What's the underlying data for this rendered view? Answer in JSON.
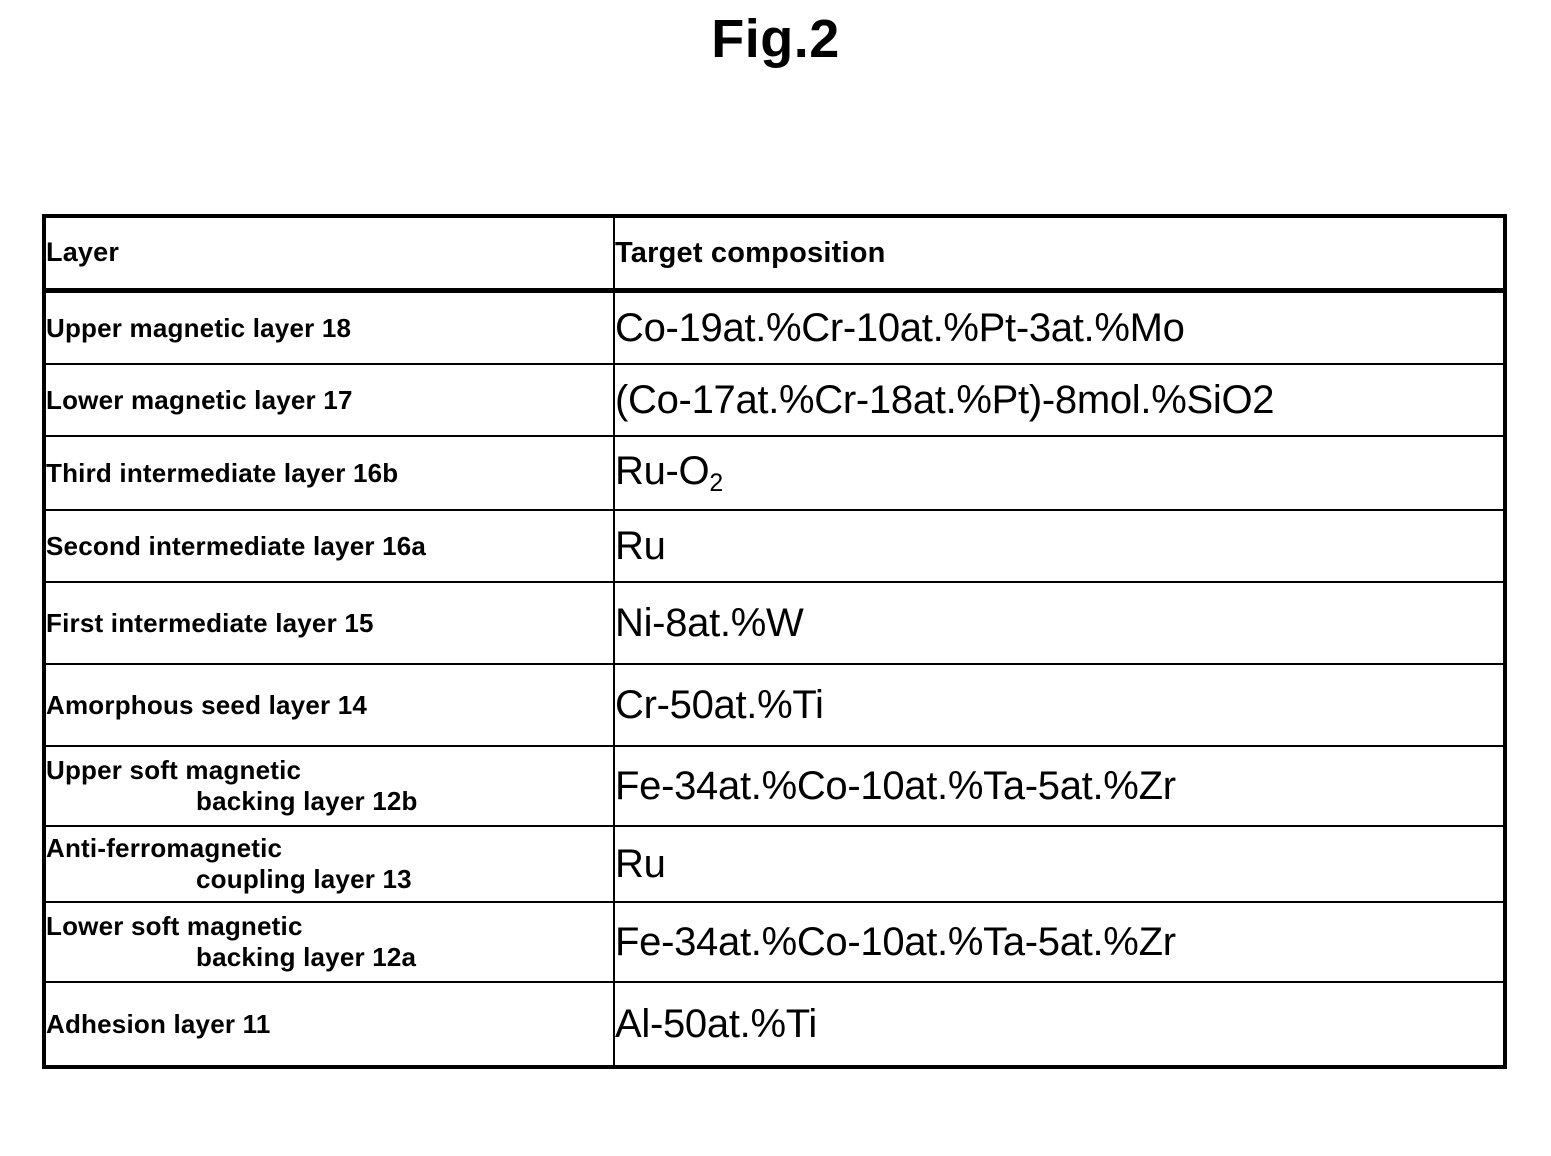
{
  "figure": {
    "title": "Fig.2"
  },
  "table": {
    "headers": {
      "layer": "Layer",
      "composition": "Target composition"
    },
    "rows": [
      {
        "layer_line1": "Upper magnetic layer 18",
        "layer_line2": "",
        "composition": "Co-19at.%Cr-10at.%Pt-3at.%Mo",
        "composition_sub": ""
      },
      {
        "layer_line1": "Lower magnetic layer 17",
        "layer_line2": "",
        "composition": "(Co-17at.%Cr-18at.%Pt)-8mol.%SiO2",
        "composition_sub": ""
      },
      {
        "layer_line1": "Third intermediate layer 16b",
        "layer_line2": "",
        "composition": "Ru-O",
        "composition_sub": "2"
      },
      {
        "layer_line1": "Second intermediate layer 16a",
        "layer_line2": "",
        "composition": "Ru",
        "composition_sub": ""
      },
      {
        "layer_line1": "First intermediate layer 15",
        "layer_line2": "",
        "composition": "Ni-8at.%W",
        "composition_sub": ""
      },
      {
        "layer_line1": "Amorphous seed layer 14",
        "layer_line2": "",
        "composition": "Cr-50at.%Ti",
        "composition_sub": ""
      },
      {
        "layer_line1": "Upper soft magnetic",
        "layer_line2": "backing layer 12b",
        "composition": "Fe-34at.%Co-10at.%Ta-5at.%Zr",
        "composition_sub": ""
      },
      {
        "layer_line1": "Anti-ferromagnetic",
        "layer_line2": "coupling layer 13",
        "composition": "Ru",
        "composition_sub": ""
      },
      {
        "layer_line1": "Lower soft magnetic",
        "layer_line2": "backing layer 12a",
        "composition": "Fe-34at.%Co-10at.%Ta-5at.%Zr",
        "composition_sub": ""
      },
      {
        "layer_line1": "Adhesion layer 11",
        "layer_line2": "",
        "composition": "Al-50at.%Ti",
        "composition_sub": ""
      }
    ]
  },
  "colors": {
    "ink": "#000000",
    "paper": "#ffffff"
  }
}
